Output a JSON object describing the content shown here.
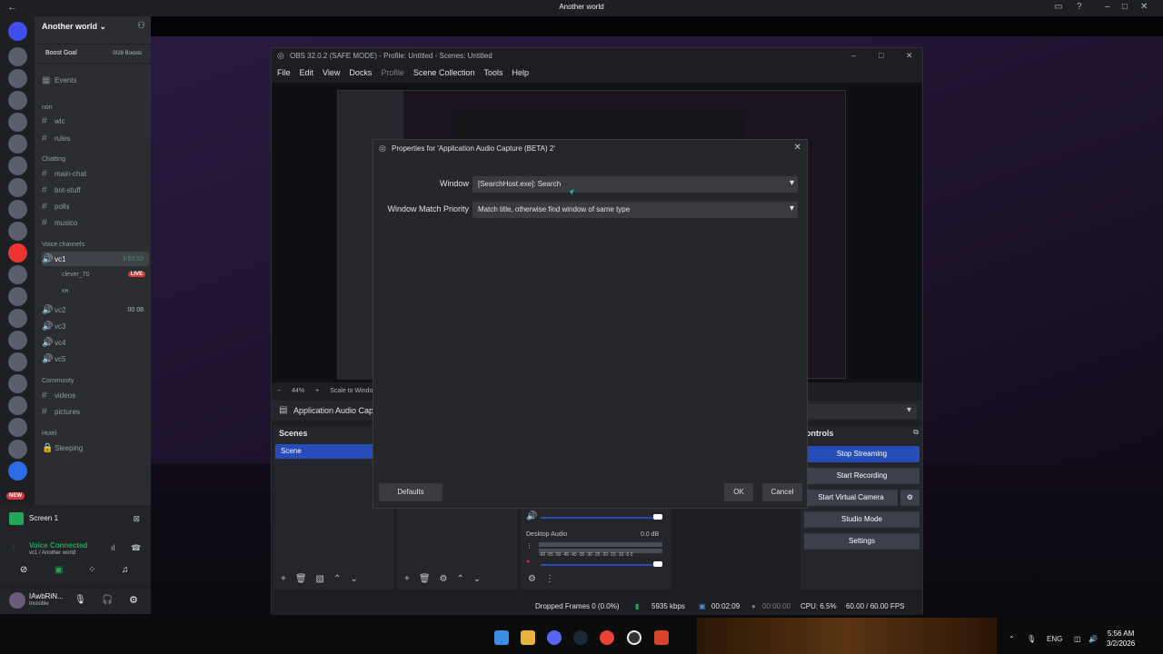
{
  "window_title": "Another world",
  "discord": {
    "guild_name": "Another world",
    "boost_goal": "Boost Goal",
    "boost_count": "0/28 Boosts",
    "events": "Events",
    "categories": {
      "non": "non",
      "chatting": "Chatting",
      "voice": "Voice channels",
      "community": "Community",
      "hotel": "Hotel"
    },
    "channels": {
      "wlc": "wlc",
      "rules": "rules",
      "main_chat": "main-chat",
      "bot_stuff": "bot-stuff",
      "polls": "polls",
      "musico": "musico",
      "vc1": "vc1",
      "vc1_time": "3:53:52",
      "vc1_user1": "clever_70",
      "vc1_user2": "ᴋʜ",
      "live": "LIVE",
      "vc2": "vc2",
      "vc2_count": "00 08",
      "vc3": "vc3",
      "vc4": "vc4",
      "vc5": "vc5",
      "videos": "videos",
      "pictures": "pictures",
      "sleeping": "Sleeping"
    },
    "voice_panel": {
      "screen": "Screen 1",
      "connected": "Voice Connected",
      "location": "vc1 / Another world"
    },
    "user": {
      "name": "IAwbRiN...",
      "status": "Invisible"
    },
    "new_badge": "NEW"
  },
  "obs": {
    "title": "OBS 32.0.2 (SAFE MODE) - Profile: Untitled - Scenes: Untitled",
    "menu": [
      "File",
      "Edit",
      "View",
      "Docks",
      "Profile",
      "Scene Collection",
      "Tools",
      "Help"
    ],
    "zoom": "44%",
    "zoom_mode": "Scale to Window",
    "source_name": "Application Audio Capture (BETA) 2",
    "source_name_short": "Application Audio Capt",
    "scenes_header": "Scenes",
    "scene_item": "Scene",
    "controls_header": "Controls",
    "controls_visible": "ontrols",
    "controls": {
      "stop_streaming": "Stop Streaming",
      "start_recording": "Start Recording",
      "start_virtual_camera": "Start Virtual Camera",
      "studio_mode": "Studio Mode",
      "settings": "Settings"
    },
    "mixer": {
      "desktop_audio": "Desktop Audio",
      "desktop_db": "0.0 dB",
      "scale": "-60 -55 -50 -45 -40 -35 -30 -25 -20 -15 -10 -5 0"
    },
    "status": {
      "dropped_frames": "Dropped Frames 0 (0.0%)",
      "bitrate": "5935 kbps",
      "stream_time": "00:02:09",
      "rec_time": "00:00:00",
      "cpu": "CPU: 6.5%",
      "fps": "60.00 / 60.00 FPS"
    }
  },
  "dialog": {
    "title": "Properties for 'Application Audio Capture (BETA) 2'",
    "window_label": "Window",
    "window_value": "[SearchHost.exe]: Search",
    "priority_label": "Window Match Priority",
    "priority_value": "Match title, otherwise find window of same type",
    "defaults": "Defaults",
    "ok": "OK",
    "cancel": "Cancel"
  },
  "taskbar": {
    "lang": "ENG",
    "time": "5:56 AM",
    "date": "3/2/2026"
  },
  "colors": {
    "accent": "#284cb8",
    "discord_green": "#23a55a",
    "live_red": "#da373c"
  }
}
